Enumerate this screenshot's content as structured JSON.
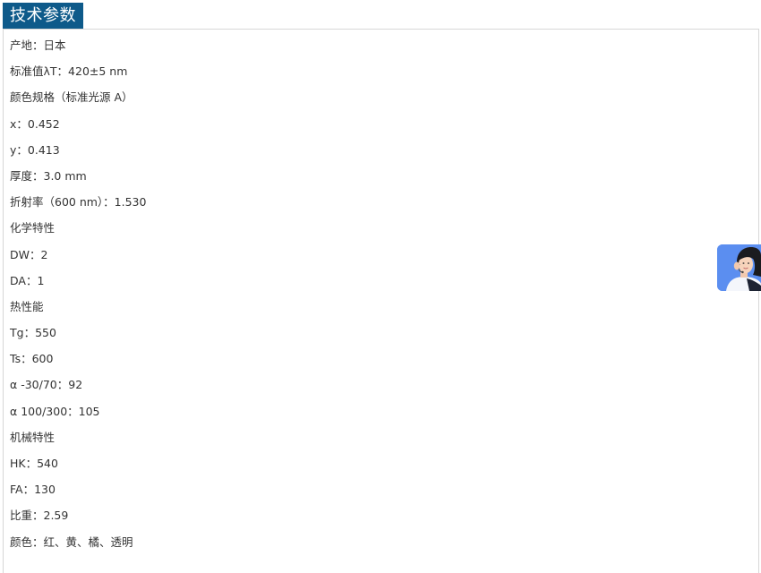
{
  "header": {
    "title": "技术参数"
  },
  "specs": [
    "产地：日本",
    "标准值λT：420±5 nm",
    "颜色规格（标准光源 A）",
    "x：0.452",
    "y：0.413",
    "厚度：3.0 mm",
    "折射率（600 nm）：1.530",
    "化学特性",
    "DW：2",
    "DA：1",
    "热性能",
    "Tg：550",
    "Ts：600",
    "α -30/70：92",
    "α 100/300：105",
    "机械特性",
    "HK：540",
    "FA：130",
    "比重：2.59",
    "颜色：红、黄、橘、透明"
  ],
  "widget": {
    "icon": "customer-service-avatar-icon",
    "accent": "#5b8ef0"
  },
  "colors": {
    "title_bg": "#0e5a8a",
    "text": "#333333",
    "border": "#d7d7d7"
  }
}
